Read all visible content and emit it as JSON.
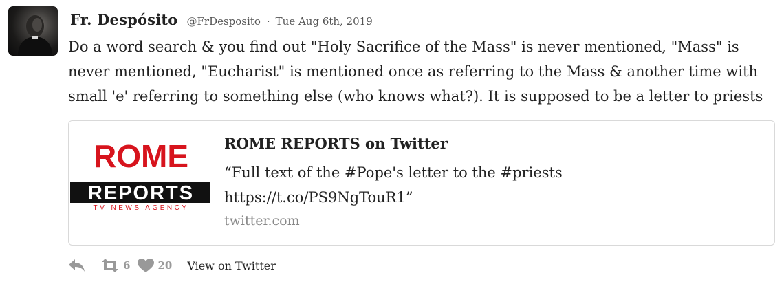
{
  "author": {
    "display_name": "Fr. Despósito",
    "handle": "@FrDesposito",
    "separator": "·",
    "date": "Tue Aug 6th, 2019"
  },
  "tweet": {
    "lines": [
      "Do a word search & you find out \"Holy Sacrifice of the Mass\" is never mentioned, \"Mass\" is",
      "never mentioned, \"Eucharist\" is mentioned once as referring to the Mass & another time with",
      "small 'e' referring to something else (who knows what?). It is supposed to be a letter to priests"
    ]
  },
  "card": {
    "image": {
      "logo_word_1": "ROME",
      "logo_word_2": "REPORTS",
      "logo_tagline": "TV NEWS AGENCY",
      "brand_color": "#d7141d"
    },
    "title": "ROME REPORTS on Twitter",
    "description_lines": [
      "“Full text of the #Pope's letter to the #priests",
      "https://t.co/PS9NgTouR1”"
    ],
    "domain": "twitter.com"
  },
  "actions": {
    "reply_icon": "reply-icon",
    "retweet_icon": "retweet-icon",
    "retweet_count": "6",
    "like_icon": "heart-icon",
    "like_count": "20",
    "view_link": "View on Twitter"
  }
}
